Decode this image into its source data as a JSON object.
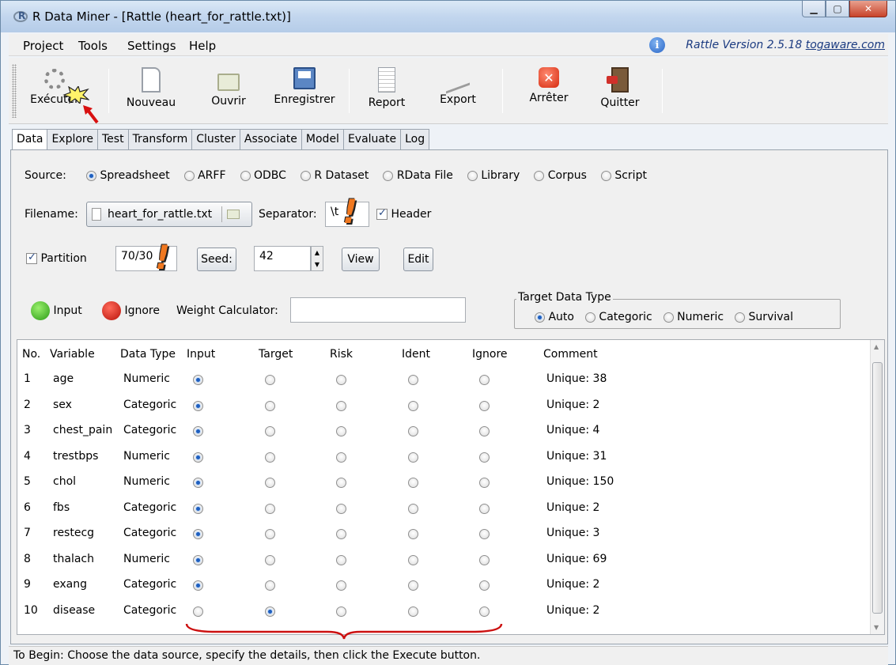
{
  "window": {
    "title": "R Data Miner - [Rattle (heart_for_rattle.txt)]"
  },
  "menu": {
    "project": "Project",
    "tools": "Tools",
    "settings": "Settings",
    "help": "Help",
    "version_text": "Rattle Version 2.5.18",
    "version_link": "togaware.com"
  },
  "toolbar": {
    "execute": "Exécuter",
    "new": "Nouveau",
    "open": "Ouvrir",
    "save": "Enregistrer",
    "report": "Report",
    "export": "Export",
    "stop": "Arrêter",
    "quit": "Quitter"
  },
  "tabs": [
    "Data",
    "Explore",
    "Test",
    "Transform",
    "Cluster",
    "Associate",
    "Model",
    "Evaluate",
    "Log"
  ],
  "source": {
    "label": "Source:",
    "options": [
      "Spreadsheet",
      "ARFF",
      "ODBC",
      "R Dataset",
      "RData File",
      "Library",
      "Corpus",
      "Script"
    ],
    "selected": "Spreadsheet"
  },
  "file": {
    "filename_label": "Filename:",
    "filename": "heart_for_rattle.txt",
    "separator_label": "Separator:",
    "separator": "\\t",
    "header_label": "Header",
    "header_checked": true
  },
  "partition": {
    "label": "Partition",
    "checked": true,
    "value": "70/30",
    "seed_label": "Seed:",
    "seed": "42",
    "view": "View",
    "edit": "Edit"
  },
  "roles": {
    "input": "Input",
    "ignore": "Ignore",
    "weight_label": "Weight Calculator:",
    "weight_value": ""
  },
  "target_type": {
    "legend": "Target Data Type",
    "options": [
      "Auto",
      "Categoric",
      "Numeric",
      "Survival"
    ],
    "selected": "Auto"
  },
  "table": {
    "headers": [
      "No.",
      "Variable",
      "Data Type",
      "Input",
      "Target",
      "Risk",
      "Ident",
      "Ignore",
      "Comment"
    ],
    "rows": [
      {
        "no": "1",
        "variable": "age",
        "type": "Numeric",
        "role": "Input",
        "comment": "Unique: 38"
      },
      {
        "no": "2",
        "variable": "sex",
        "type": "Categoric",
        "role": "Input",
        "comment": "Unique: 2"
      },
      {
        "no": "3",
        "variable": "chest_pain",
        "type": "Categoric",
        "role": "Input",
        "comment": "Unique: 4"
      },
      {
        "no": "4",
        "variable": "trestbps",
        "type": "Numeric",
        "role": "Input",
        "comment": "Unique: 31"
      },
      {
        "no": "5",
        "variable": "chol",
        "type": "Numeric",
        "role": "Input",
        "comment": "Unique: 150"
      },
      {
        "no": "6",
        "variable": "fbs",
        "type": "Categoric",
        "role": "Input",
        "comment": "Unique: 2"
      },
      {
        "no": "7",
        "variable": "restecg",
        "type": "Categoric",
        "role": "Input",
        "comment": "Unique: 3"
      },
      {
        "no": "8",
        "variable": "thalach",
        "type": "Numeric",
        "role": "Input",
        "comment": "Unique: 69"
      },
      {
        "no": "9",
        "variable": "exang",
        "type": "Categoric",
        "role": "Input",
        "comment": "Unique: 2"
      },
      {
        "no": "10",
        "variable": "disease",
        "type": "Categoric",
        "role": "Target",
        "comment": "Unique: 2"
      }
    ]
  },
  "status": "To Begin: Choose the data source, specify the details, then click the Execute button.",
  "colors": {
    "accent": "#1f5fbf",
    "annotation": "#f07820",
    "brace": "#cc1010"
  },
  "icons": [
    "gear-icon",
    "new-doc-icon",
    "folder-icon",
    "save-icon",
    "report-icon",
    "export-icon",
    "stop-icon",
    "quit-icon",
    "info-icon"
  ]
}
